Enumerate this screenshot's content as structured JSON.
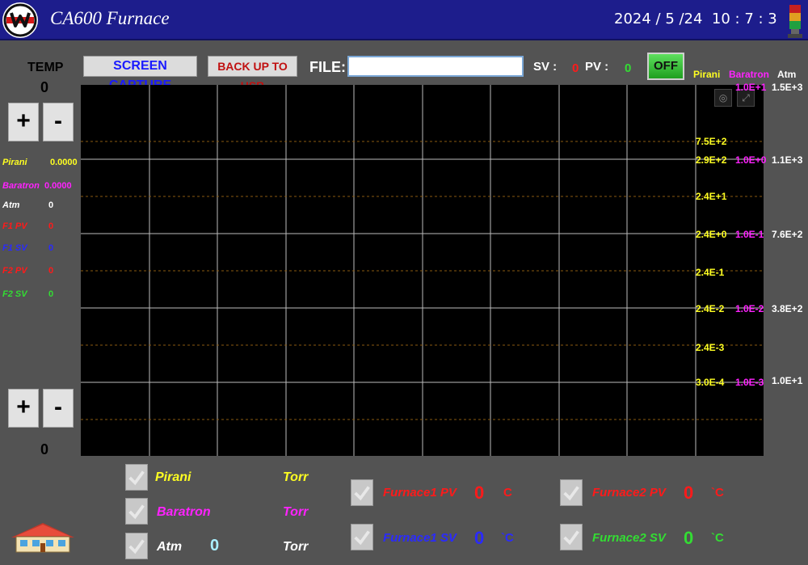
{
  "header": {
    "title": "CA600 Furnace",
    "clock": "2024 / 5 /24  10 : 7 : 3"
  },
  "toolbar": {
    "temp_label": "TEMP",
    "screen_capture": "SCREEN CAPTURE",
    "backup_usb": "BACK UP TO USB",
    "file_label": "FILE:",
    "file_value": "",
    "sv_label": "SV :",
    "sv_value": "0",
    "pv_label": "PV :",
    "pv_value": "0",
    "off_button": "OFF"
  },
  "left_panel": {
    "temp_top": "0",
    "temp_bottom": "0",
    "plus": "+",
    "minus": "-",
    "readings": [
      {
        "label": "Pirani",
        "value": "0.0000",
        "color": "#ffff22"
      },
      {
        "label": "Baratron",
        "value": "0.0000",
        "color": "#ff22ff"
      },
      {
        "label": "Atm",
        "value": "0",
        "color": "#ffffff"
      },
      {
        "label": "F1 PV",
        "value": "0",
        "color": "#ff1a1a"
      },
      {
        "label": "F1 SV",
        "value": "0",
        "color": "#2a2aff"
      },
      {
        "label": "F2 PV",
        "value": "0",
        "color": "#ff1a1a"
      },
      {
        "label": "F2 SV",
        "value": "0",
        "color": "#33dd33"
      }
    ]
  },
  "axes": {
    "pirani_header": "Pirani",
    "baratron_header": "Baratron",
    "atm_header": "Atm",
    "pirani_ticks": [
      "7.5E+2",
      "2.9E+2",
      "2.4E+1",
      "2.4E+0",
      "2.4E-1",
      "2.4E-2",
      "2.4E-3",
      "3.0E-4"
    ],
    "baratron_ticks": [
      "1.0E+1",
      "1.0E+0",
      "1.0E-1",
      "1.0E-2",
      "1.0E-3"
    ],
    "atm_ticks": [
      "1.5E+3",
      "1.1E+3",
      "7.6E+2",
      "3.8E+2",
      "1.0E+1"
    ]
  },
  "chart_data": {
    "type": "line",
    "series": [],
    "grid": true
  },
  "legend": {
    "pirani": {
      "label": "Pirani",
      "unit": "Torr"
    },
    "baratron": {
      "label": "Baratron",
      "unit": "Torr"
    },
    "atm": {
      "label": "Atm",
      "value": "0",
      "unit": "Torr"
    },
    "furnace1_pv": {
      "label": "Furnace1 PV",
      "value": "0",
      "unit": "C"
    },
    "furnace1_sv": {
      "label": "Furnace1 SV",
      "value": "0",
      "unit": "`C"
    },
    "furnace2_pv": {
      "label": "Furnace2 PV",
      "value": "0",
      "unit": "`C"
    },
    "furnace2_sv": {
      "label": "Furnace2 SV",
      "value": "0",
      "unit": "`C"
    }
  },
  "icons": {
    "logo": "company-logo-icon",
    "stack_light": "stack-light-icon",
    "home": "home-icon",
    "checkbox": "checkbox-check-icon",
    "target": "target-icon",
    "expand": "expand-icon"
  }
}
